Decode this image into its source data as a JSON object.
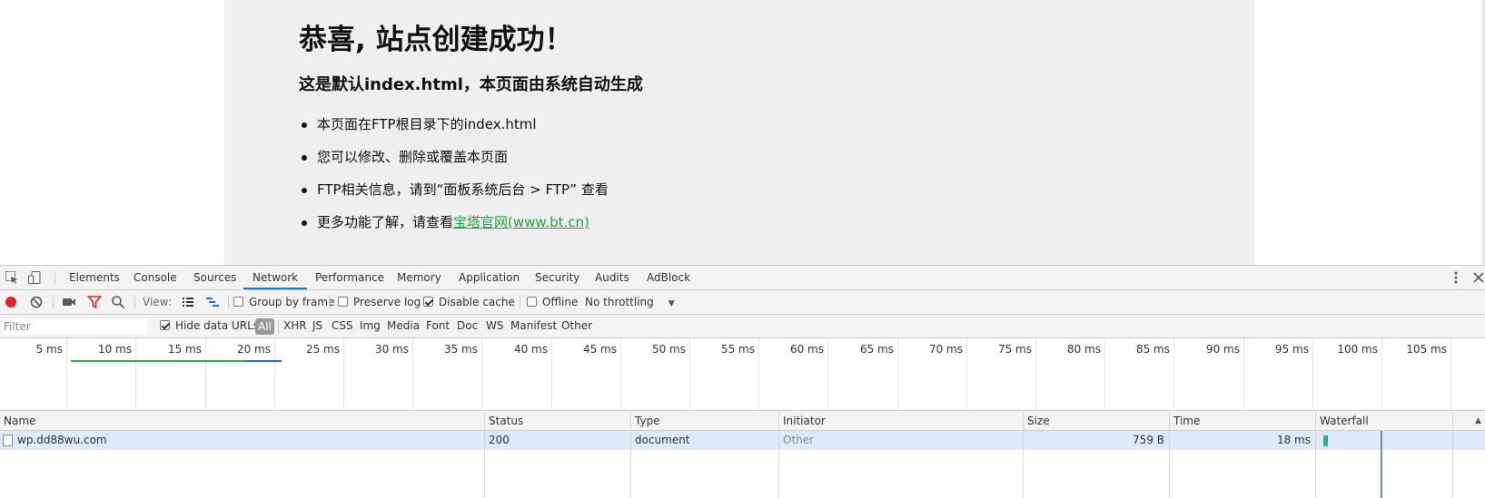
{
  "webpage": {
    "title": "恭喜, 站点创建成功！",
    "subtitle": "这是默认index.html，本页面由系统自动生成",
    "items": [
      "本页面在FTP根目录下的index.html",
      "您可以修改、删除或覆盖本页面",
      "FTP相关信息，请到“面板系统后台 > FTP” 查看"
    ],
    "last_item_text": "更多功能了解，请查看",
    "last_item_link": "宝塔官网(www.bt.cn)",
    "link_color": "#20a53a"
  },
  "devtools": {
    "tabs": [
      "Elements",
      "Console",
      "Sources",
      "Network",
      "Performance",
      "Memory",
      "Application",
      "Security",
      "Audits",
      "AdBlock"
    ],
    "active_tab": "Network",
    "toolbar": {
      "view_label": "View:",
      "group_by_frame": "Group by frame",
      "preserve_log": "Preserve log",
      "disable_cache": "Disable cache",
      "offline": "Offline",
      "throttling": "No throttling",
      "disable_cache_checked": true
    },
    "filter": {
      "placeholder": "Filter",
      "hide_data_urls": "Hide data URLs",
      "types": [
        "All",
        "XHR",
        "JS",
        "CSS",
        "Img",
        "Media",
        "Font",
        "Doc",
        "WS",
        "Manifest",
        "Other"
      ]
    },
    "overview_ticks": [
      "5 ms",
      "10 ms",
      "15 ms",
      "20 ms",
      "25 ms",
      "30 ms",
      "35 ms",
      "40 ms",
      "45 ms",
      "50 ms",
      "55 ms",
      "60 ms",
      "65 ms",
      "70 ms",
      "75 ms",
      "80 ms",
      "85 ms",
      "90 ms",
      "95 ms",
      "100 ms",
      "105 ms"
    ],
    "columns": [
      "Name",
      "Status",
      "Type",
      "Initiator",
      "Size",
      "Time",
      "Waterfall"
    ],
    "rows": [
      {
        "name": "wp.dd88wu.com",
        "status": "200",
        "type": "document",
        "initiator": "Other",
        "size": "759 B",
        "time": "18 ms"
      }
    ],
    "accent_color": "#1a73e8"
  }
}
